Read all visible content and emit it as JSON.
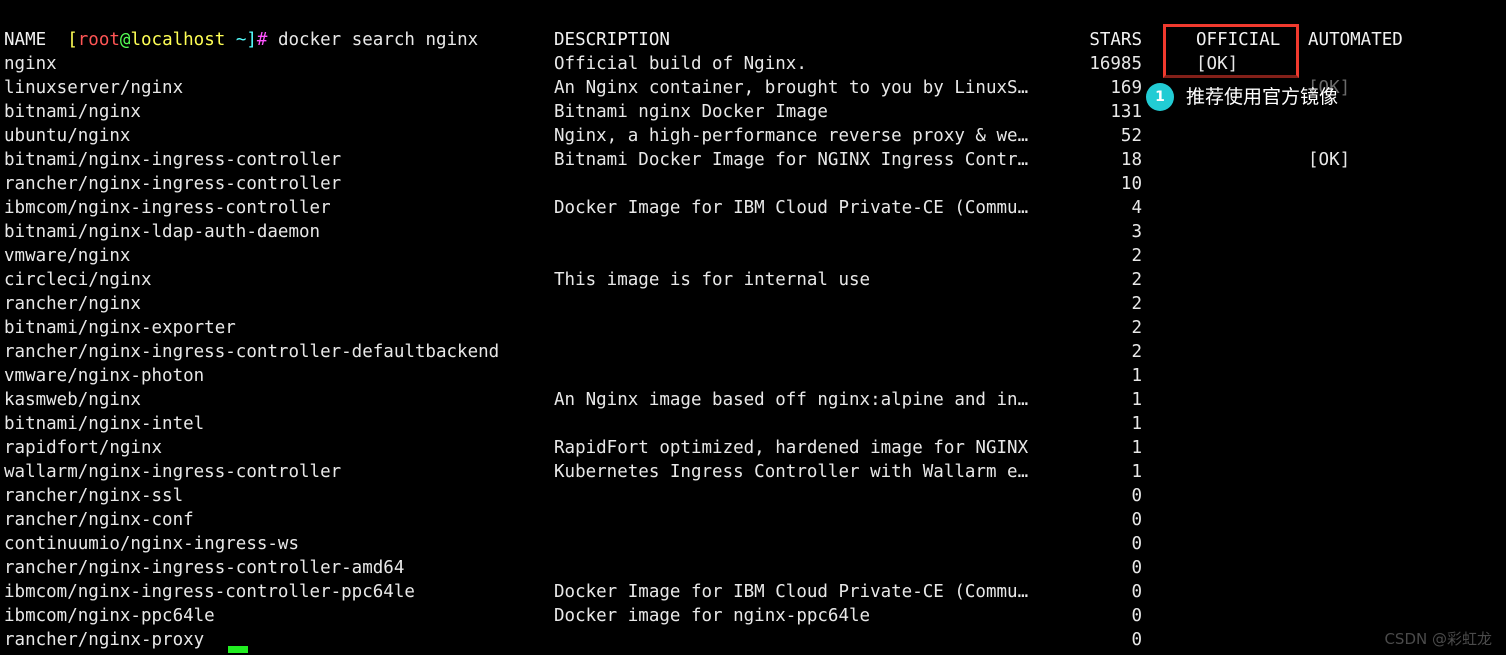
{
  "terminal": {
    "prompt": {
      "open_bracket": "[",
      "user": "root",
      "at": "@",
      "host": "localhost",
      "path": " ~]",
      "sigil": "#",
      "command": " docker search nginx"
    },
    "headers": {
      "name": "NAME",
      "description": "DESCRIPTION",
      "stars": "STARS",
      "official": "OFFICIAL",
      "automated": "AUTOMATED"
    },
    "rows": [
      {
        "name": "nginx",
        "description": "Official build of Nginx.",
        "stars": "16985",
        "official": "[OK]",
        "automated": ""
      },
      {
        "name": "linuxserver/nginx",
        "description": "An Nginx container, brought to you by LinuxS…",
        "stars": "169",
        "official": "",
        "automated": "[OK]"
      },
      {
        "name": "bitnami/nginx",
        "description": "Bitnami nginx Docker Image",
        "stars": "131",
        "official": "",
        "automated": ""
      },
      {
        "name": "ubuntu/nginx",
        "description": "Nginx, a high-performance reverse proxy & we…",
        "stars": "52",
        "official": "",
        "automated": ""
      },
      {
        "name": "bitnami/nginx-ingress-controller",
        "description": "Bitnami Docker Image for NGINX Ingress Contr…",
        "stars": "18",
        "official": "",
        "automated": "[OK]"
      },
      {
        "name": "rancher/nginx-ingress-controller",
        "description": "",
        "stars": "10",
        "official": "",
        "automated": ""
      },
      {
        "name": "ibmcom/nginx-ingress-controller",
        "description": "Docker Image for IBM Cloud Private-CE (Commu…",
        "stars": "4",
        "official": "",
        "automated": ""
      },
      {
        "name": "bitnami/nginx-ldap-auth-daemon",
        "description": "",
        "stars": "3",
        "official": "",
        "automated": ""
      },
      {
        "name": "vmware/nginx",
        "description": "",
        "stars": "2",
        "official": "",
        "automated": ""
      },
      {
        "name": "circleci/nginx",
        "description": "This image is for internal use",
        "stars": "2",
        "official": "",
        "automated": ""
      },
      {
        "name": "rancher/nginx",
        "description": "",
        "stars": "2",
        "official": "",
        "automated": ""
      },
      {
        "name": "bitnami/nginx-exporter",
        "description": "",
        "stars": "2",
        "official": "",
        "automated": ""
      },
      {
        "name": "rancher/nginx-ingress-controller-defaultbackend",
        "description": "",
        "stars": "2",
        "official": "",
        "automated": ""
      },
      {
        "name": "vmware/nginx-photon",
        "description": "",
        "stars": "1",
        "official": "",
        "automated": ""
      },
      {
        "name": "kasmweb/nginx",
        "description": "An Nginx image based off nginx:alpine and in…",
        "stars": "1",
        "official": "",
        "automated": ""
      },
      {
        "name": "bitnami/nginx-intel",
        "description": "",
        "stars": "1",
        "official": "",
        "automated": ""
      },
      {
        "name": "rapidfort/nginx",
        "description": "RapidFort optimized, hardened image for NGINX",
        "stars": "1",
        "official": "",
        "automated": ""
      },
      {
        "name": "wallarm/nginx-ingress-controller",
        "description": "Kubernetes Ingress Controller with Wallarm e…",
        "stars": "1",
        "official": "",
        "automated": ""
      },
      {
        "name": "rancher/nginx-ssl",
        "description": "",
        "stars": "0",
        "official": "",
        "automated": ""
      },
      {
        "name": "rancher/nginx-conf",
        "description": "",
        "stars": "0",
        "official": "",
        "automated": ""
      },
      {
        "name": "continuumio/nginx-ingress-ws",
        "description": "",
        "stars": "0",
        "official": "",
        "automated": ""
      },
      {
        "name": "rancher/nginx-ingress-controller-amd64",
        "description": "",
        "stars": "0",
        "official": "",
        "automated": ""
      },
      {
        "name": "ibmcom/nginx-ingress-controller-ppc64le",
        "description": "Docker Image for IBM Cloud Private-CE (Commu…",
        "stars": "0",
        "official": "",
        "automated": ""
      },
      {
        "name": "ibmcom/nginx-ppc64le",
        "description": "Docker image for nginx-ppc64le",
        "stars": "0",
        "official": "",
        "automated": ""
      },
      {
        "name": "rancher/nginx-proxy",
        "description": "",
        "stars": "0",
        "official": "",
        "automated": ""
      }
    ]
  },
  "annotation": {
    "step_number": "1",
    "note": "推荐使用官方镜像",
    "box_color": "#f03a2e",
    "badge_color": "#22ccd4"
  },
  "watermark": {
    "text": "CSDN @彩虹龙"
  }
}
